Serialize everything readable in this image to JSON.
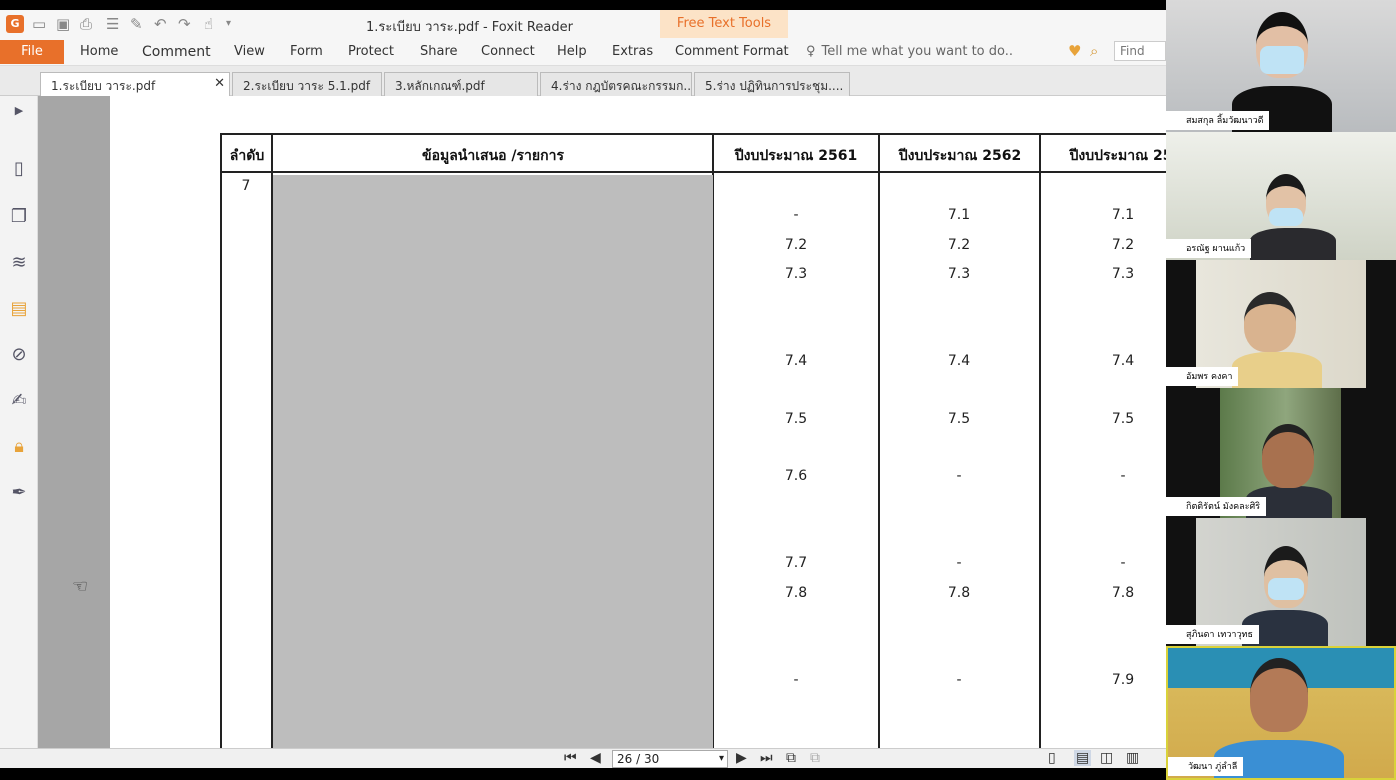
{
  "window": {
    "title": "1.ระเบียบ วาระ.pdf - Foxit Reader",
    "context_tab_title": "Free Text Tools"
  },
  "ribbon": {
    "file": "File",
    "tabs": [
      "Home",
      "Comment",
      "View",
      "Form",
      "Protect",
      "Share",
      "Connect",
      "Help",
      "Extras",
      "Comment Format"
    ],
    "tell_me": "Tell me what you want to do..",
    "find_placeholder": "Find"
  },
  "doc_tabs": [
    {
      "label": "1.ระเบียบ วาระ.pdf",
      "active": true
    },
    {
      "label": "2.ระเบียบ วาระ 5.1.pdf",
      "active": false
    },
    {
      "label": "3.หลักเกณฑ์.pdf",
      "active": false
    },
    {
      "label": "4.ร่าง กฎบัตรคณะกรรมก...",
      "active": false
    },
    {
      "label": "5.ร่าง ปฏิทินการประชุม....",
      "active": false
    }
  ],
  "table": {
    "headers": [
      "ลำดับ",
      "ข้อมูลนำเสนอ /รายการ",
      "ปีงบประมาณ 2561",
      "ปีงบประมาณ 2562",
      "ปีงบประมาณ 25"
    ],
    "row_number": "7",
    "rows": [
      [
        "-",
        "7.1",
        "7.1"
      ],
      [
        "7.2",
        "7.2",
        "7.2"
      ],
      [
        "7.3",
        "7.3",
        "7.3"
      ],
      [
        "7.4",
        "7.4",
        "7.4"
      ],
      [
        "7.5",
        "7.5",
        "7.5"
      ],
      [
        "7.6",
        "-",
        "-"
      ],
      [
        "7.7",
        "-",
        "-"
      ],
      [
        "7.8",
        "7.8",
        "7.8"
      ],
      [
        "-",
        "-",
        "7.9"
      ]
    ]
  },
  "statusbar": {
    "page": "26 / 30"
  },
  "participants": [
    "สมสกุล ลิ้มวัฒนาวดี",
    "อรณัฐ ผานแก้ว",
    "อัมพร คงคา",
    "กิตติรัตน์ มังคละศิริ",
    "สุภินดา เทวาวุทธ",
    "วัฒนา ภู่ลำลี"
  ]
}
